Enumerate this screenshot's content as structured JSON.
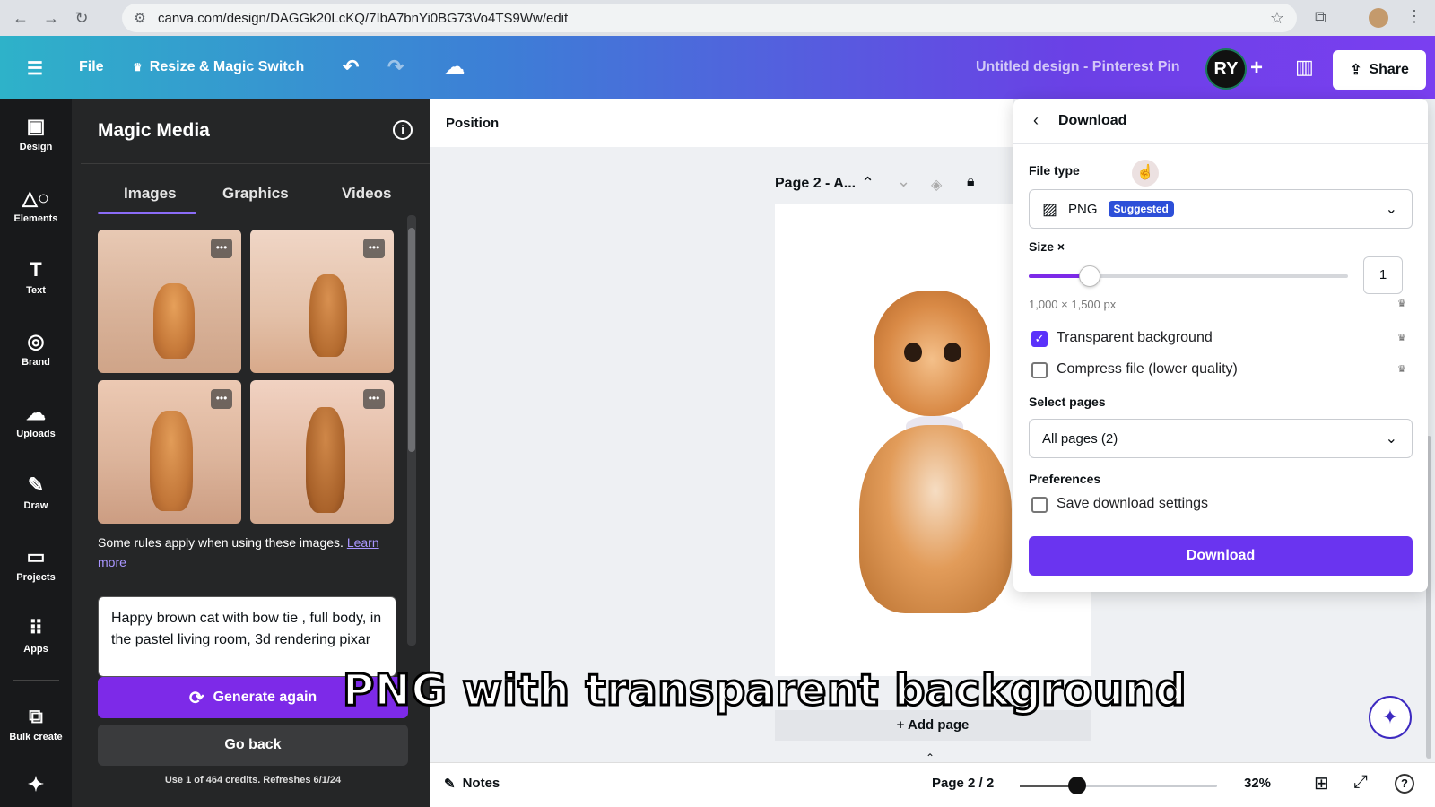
{
  "browser": {
    "url": "canva.com/design/DAGGk20LcKQ/7IbA7bnYi0BG73Vo4TS9Ww/edit"
  },
  "header": {
    "file_label": "File",
    "resize_label": "Resize & Magic Switch",
    "design_title": "Untitled design - Pinterest Pin",
    "avatar_initials": "RY",
    "share_label": "Share",
    "gradient_colors": [
      "#2eb2c9",
      "#6b40e6",
      "#7a3ff0"
    ]
  },
  "rail": {
    "items": [
      {
        "label": "Design",
        "icon": "design-icon"
      },
      {
        "label": "Elements",
        "icon": "elements-icon"
      },
      {
        "label": "Text",
        "icon": "text-icon"
      },
      {
        "label": "Brand",
        "icon": "brand-icon"
      },
      {
        "label": "Uploads",
        "icon": "uploads-icon"
      },
      {
        "label": "Draw",
        "icon": "draw-icon"
      },
      {
        "label": "Projects",
        "icon": "projects-icon"
      },
      {
        "label": "Apps",
        "icon": "apps-icon"
      },
      {
        "label": "Bulk create",
        "icon": "bulk-create-icon"
      }
    ]
  },
  "panel": {
    "title": "Magic Media",
    "tabs": [
      "Images",
      "Graphics",
      "Videos"
    ],
    "active_tab": "Images",
    "rules_text": "Some rules apply when using these images.",
    "learn_more": "Learn",
    "learn_more2": "more",
    "prompt": "Happy brown cat with bow tie , full body, in the pastel living room, 3d rendering pixar",
    "generate_again": "Generate again",
    "go_back": "Go back",
    "credits": "Use 1 of 464 credits. Refreshes 6/1/24"
  },
  "canvas": {
    "position_label": "Position",
    "page_label": "Page 2 - A...",
    "add_page": "+ Add page"
  },
  "bottom": {
    "notes": "Notes",
    "page_counter": "Page 2 / 2",
    "zoom": "32%"
  },
  "download": {
    "title": "Download",
    "file_type_label": "File type",
    "file_type_value": "PNG",
    "suggested_badge": "Suggested",
    "size_label": "Size ×",
    "size_value": "1",
    "size_slider_fraction": 0.19,
    "dimensions": "1,000 × 1,500 px",
    "transparent_bg": "Transparent background",
    "transparent_checked": true,
    "compress": "Compress file (lower quality)",
    "compress_checked": false,
    "select_pages_label": "Select pages",
    "select_pages_value": "All pages (2)",
    "preferences_label": "Preferences",
    "save_settings": "Save download settings",
    "download_button": "Download"
  },
  "caption": "PNG with transparent background",
  "accent": "#6a34f0"
}
